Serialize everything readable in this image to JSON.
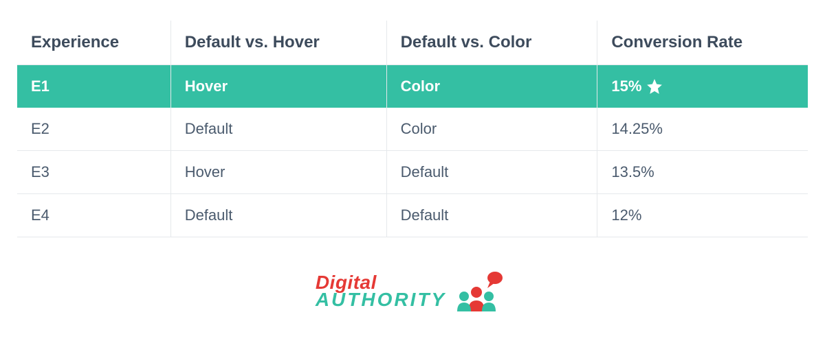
{
  "table": {
    "headers": [
      "Experience",
      "Default vs. Hover",
      "Default vs. Color",
      "Conversion Rate"
    ],
    "rows": [
      {
        "experience": "E1",
        "hover": "Hover",
        "color": "Color",
        "rate": "15%",
        "highlight": true,
        "star": true
      },
      {
        "experience": "E2",
        "hover": "Default",
        "color": "Color",
        "rate": "14.25%",
        "highlight": false,
        "star": false
      },
      {
        "experience": "E3",
        "hover": "Hover",
        "color": "Default",
        "rate": "13.5%",
        "highlight": false,
        "star": false
      },
      {
        "experience": "E4",
        "hover": "Default",
        "color": "Default",
        "rate": "12%",
        "highlight": false,
        "star": false
      }
    ]
  },
  "logo": {
    "line1": "Digital",
    "line2": "AUTHORITY"
  }
}
